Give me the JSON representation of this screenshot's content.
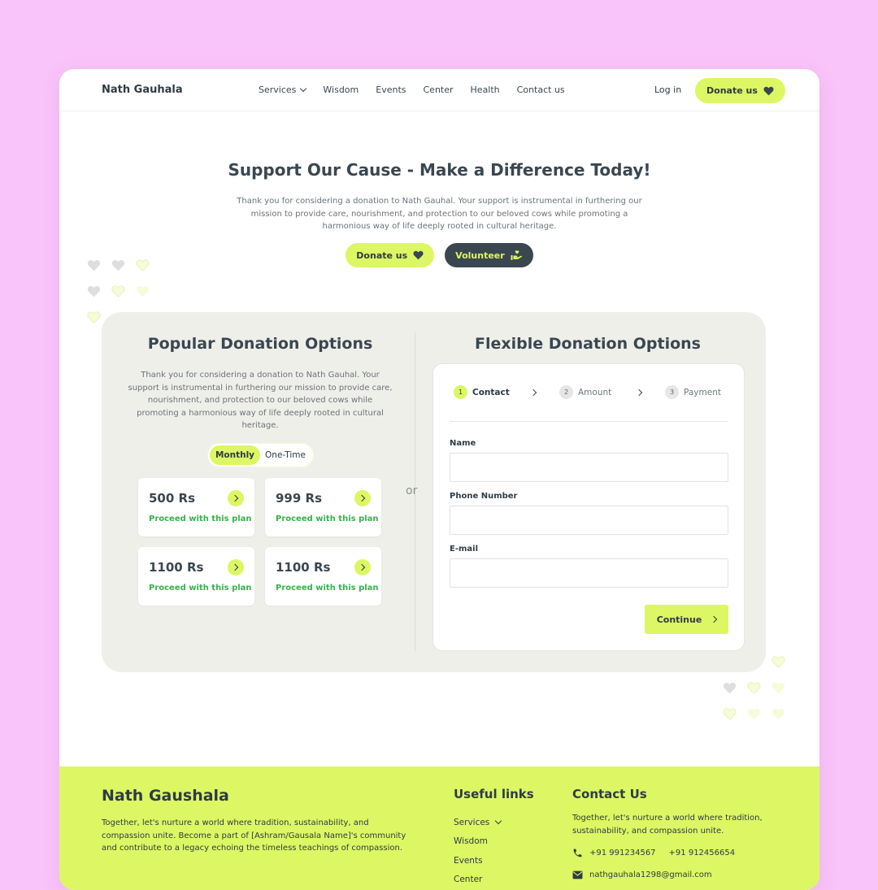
{
  "nav": {
    "brand": "Nath Gauhala",
    "items": [
      {
        "label": "Services"
      },
      {
        "label": "Wisdom"
      },
      {
        "label": "Events"
      },
      {
        "label": "Center"
      },
      {
        "label": "Health"
      },
      {
        "label": "Contact us"
      }
    ],
    "login": "Log in",
    "donate": "Donate us"
  },
  "hero": {
    "title": "Support Our Cause - Make a Difference Today!",
    "description": "Thank you for considering a donation to Nath Gauhal. Your support is instrumental in furthering our mission to provide care, nourishment, and protection to our beloved cows while promoting a harmonious way of life deeply rooted in cultural heritage.",
    "donate_label": "Donate us",
    "volunteer_label": "Volunteer"
  },
  "popular": {
    "title": "Popular Donation Options",
    "description": "Thank you for considering a donation to Nath Gauhal. Your support is instrumental in furthering our mission to provide care, nourishment, and protection to our beloved cows while promoting a harmonious way of life deeply rooted in cultural heritage.",
    "toggle": {
      "active": "Monthly",
      "inactive": "One-Time"
    },
    "plans": [
      {
        "amount": "500 Rs",
        "cta": "Proceed with this plan"
      },
      {
        "amount": "999 Rs",
        "cta": "Proceed with this plan"
      },
      {
        "amount": "1100 Rs",
        "cta": "Proceed with this plan"
      },
      {
        "amount": "1100 Rs",
        "cta": "Proceed with this plan"
      }
    ]
  },
  "or_label": "or",
  "flexible": {
    "title": "Flexible Donation Options",
    "steps": [
      {
        "num": "1",
        "label": "Contact"
      },
      {
        "num": "2",
        "label": "Amount"
      },
      {
        "num": "3",
        "label": "Payment"
      }
    ],
    "fields": [
      {
        "label": "Name",
        "value": ""
      },
      {
        "label": "Phone Number",
        "value": ""
      },
      {
        "label": "E-mail",
        "value": ""
      }
    ],
    "continue": "Continue"
  },
  "footer": {
    "brand": "Nath Gaushala",
    "description": "Together, let's nurture a world where tradition, sustainability, and compassion unite. Become a part of [Ashram/Gausala Name]'s community and contribute to a legacy echoing the timeless teachings of compassion.",
    "links_title": "Useful links",
    "links": [
      "Services",
      "Wisdom",
      "Events",
      "Center"
    ],
    "contact_title": "Contact Us",
    "contact_desc": "Together, let's nurture a world where tradition, sustainability, and compassion unite.",
    "phone1": "+91 991234567",
    "phone2": "+91 912456654",
    "email": "nathgauhala1298@gmail.com"
  },
  "colors": {
    "accent": "#dcf763",
    "dark": "#3a4750",
    "background": "#f9c4f9",
    "success": "#36b24a"
  },
  "icons": [
    "chevron-down-icon",
    "heart-icon",
    "volunteer-hand-icon",
    "arrow-right-icon",
    "phone-icon",
    "mail-icon"
  ]
}
